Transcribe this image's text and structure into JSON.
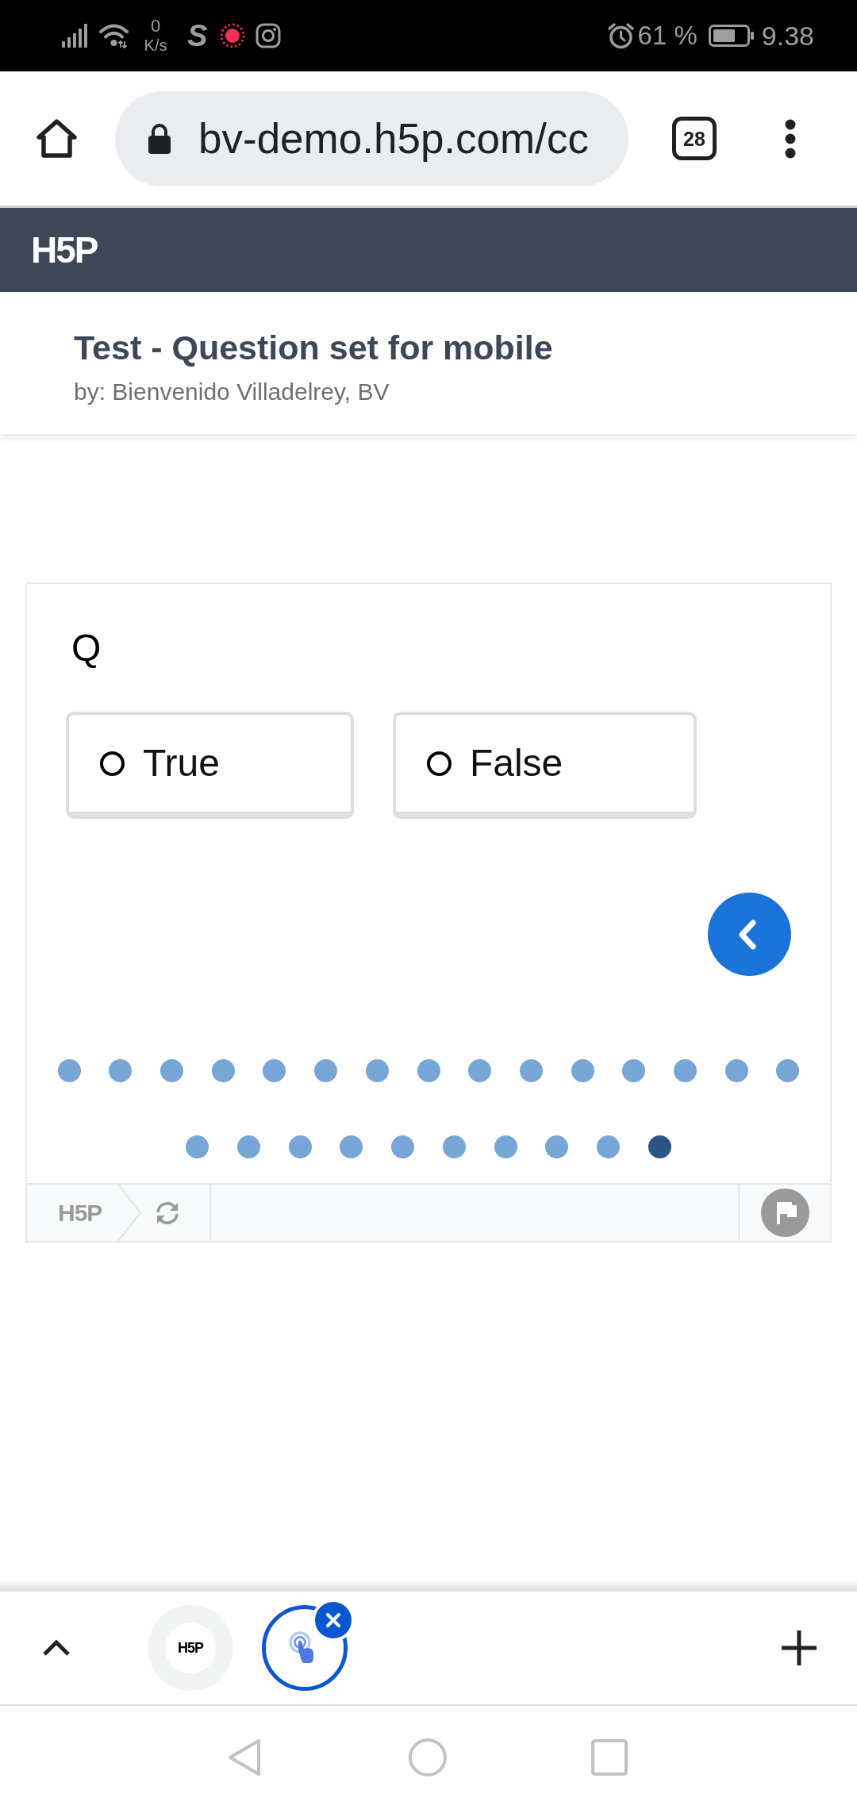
{
  "status_bar": {
    "network_speed": "0",
    "network_speed_unit": "K/s",
    "app_icon_letter": "S",
    "battery_percent": "61 %",
    "time": "9.38"
  },
  "browser_toolbar": {
    "url": "bv-demo.h5p.com/cc",
    "tab_count": "28"
  },
  "site_header": {
    "logo": "H5P"
  },
  "content_header": {
    "title": "Test - Question set for mobile",
    "byline": "by: Bienvenido Villadelrey, BV"
  },
  "question_set": {
    "question": "Q",
    "options": [
      {
        "label": "True",
        "selected": false
      },
      {
        "label": "False",
        "selected": false
      }
    ],
    "progress_dots": [
      {
        "selected": false
      },
      {
        "selected": false
      },
      {
        "selected": false
      },
      {
        "selected": false
      },
      {
        "selected": false
      },
      {
        "selected": false
      },
      {
        "selected": false
      },
      {
        "selected": false
      },
      {
        "selected": false
      },
      {
        "selected": false
      },
      {
        "selected": false
      },
      {
        "selected": false
      },
      {
        "selected": false
      },
      {
        "selected": false
      },
      {
        "selected": false
      },
      {
        "selected": false
      },
      {
        "selected": false
      },
      {
        "selected": false
      },
      {
        "selected": false
      },
      {
        "selected": false
      },
      {
        "selected": false
      },
      {
        "selected": false
      },
      {
        "selected": false
      },
      {
        "selected": false
      },
      {
        "selected": true
      }
    ],
    "footer_logo": "H5P"
  },
  "tab_strip": {
    "tabs": [
      {
        "kind": "favicon",
        "favicon": "H5P",
        "selected": false
      },
      {
        "kind": "touch",
        "selected": true
      }
    ]
  }
}
